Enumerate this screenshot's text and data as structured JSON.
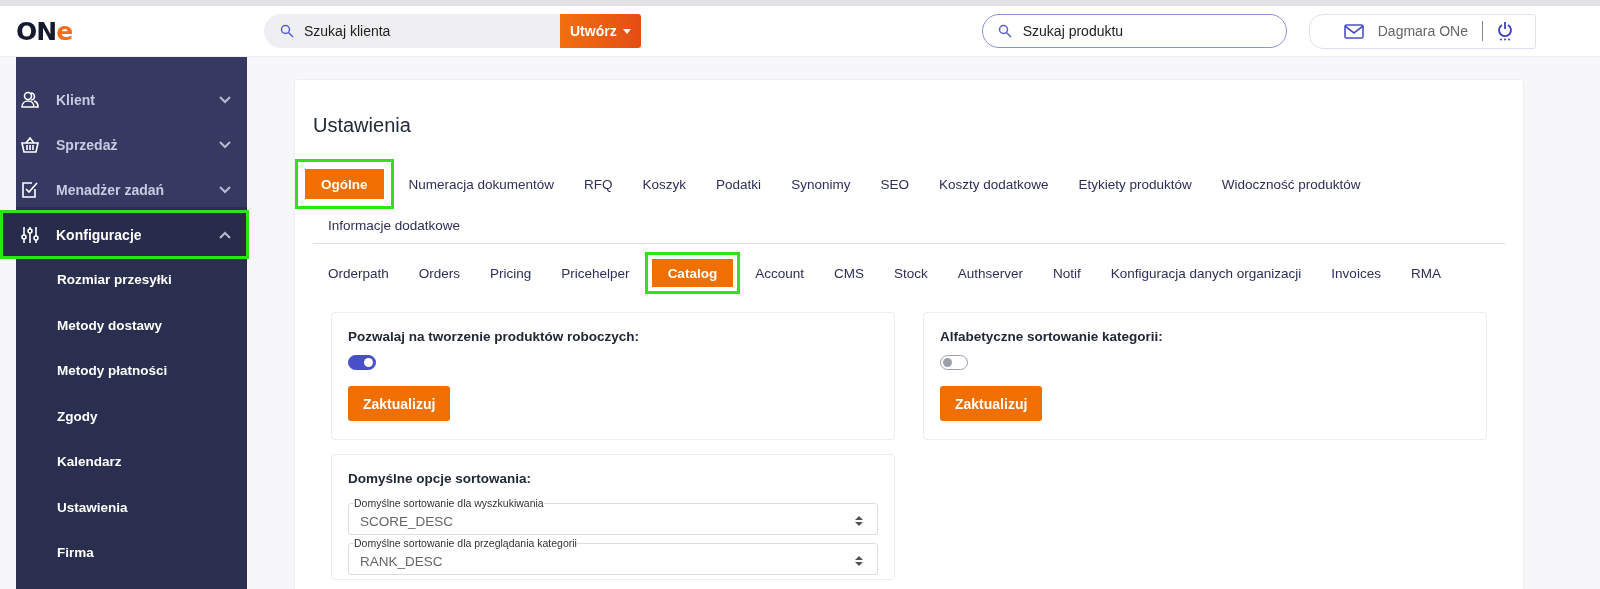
{
  "header": {
    "logo": {
      "text": "ON",
      "accent": "e"
    },
    "client_search": {
      "placeholder": "Szukaj klienta"
    },
    "create_button": {
      "label": "Utwórz"
    },
    "product_search": {
      "placeholder": "Szukaj produktu"
    },
    "user": {
      "name": "Dagmara ONe"
    }
  },
  "sidebar": {
    "items": [
      {
        "label": "Klient",
        "expanded": false,
        "highlighted": false
      },
      {
        "label": "Sprzedaż",
        "expanded": false,
        "highlighted": false
      },
      {
        "label": "Menadżer zadań",
        "expanded": false,
        "highlighted": false
      },
      {
        "label": "Konfiguracje",
        "expanded": true,
        "highlighted": true,
        "children": [
          {
            "label": "Rozmiar przesyłki"
          },
          {
            "label": "Metody dostawy"
          },
          {
            "label": "Metody płatności"
          },
          {
            "label": "Zgody"
          },
          {
            "label": "Kalendarz"
          },
          {
            "label": "Ustawienia"
          },
          {
            "label": "Firma"
          }
        ]
      }
    ]
  },
  "page": {
    "title": "Ustawienia",
    "tabs": [
      {
        "label": "Ogólne",
        "selected": true,
        "highlighted": true
      },
      {
        "label": "Numeracja dokumentów",
        "selected": false,
        "highlighted": false
      },
      {
        "label": "RFQ",
        "selected": false,
        "highlighted": false
      },
      {
        "label": "Koszyk",
        "selected": false,
        "highlighted": false
      },
      {
        "label": "Podatki",
        "selected": false,
        "highlighted": false
      },
      {
        "label": "Synonimy",
        "selected": false,
        "highlighted": false
      },
      {
        "label": "SEO",
        "selected": false,
        "highlighted": false
      },
      {
        "label": "Koszty dodatkowe",
        "selected": false,
        "highlighted": false
      },
      {
        "label": "Etykiety produktów",
        "selected": false,
        "highlighted": false
      },
      {
        "label": "Widoczność produktów",
        "selected": false,
        "highlighted": false
      },
      {
        "label": "Informacje dodatkowe",
        "selected": false,
        "highlighted": false
      }
    ],
    "subtabs": [
      {
        "label": "Orderpath",
        "selected": false,
        "highlighted": false
      },
      {
        "label": "Orders",
        "selected": false,
        "highlighted": false
      },
      {
        "label": "Pricing",
        "selected": false,
        "highlighted": false
      },
      {
        "label": "Pricehelper",
        "selected": false,
        "highlighted": false
      },
      {
        "label": "Catalog",
        "selected": true,
        "highlighted": true
      },
      {
        "label": "Account",
        "selected": false,
        "highlighted": false
      },
      {
        "label": "CMS",
        "selected": false,
        "highlighted": false
      },
      {
        "label": "Stock",
        "selected": false,
        "highlighted": false
      },
      {
        "label": "Authserver",
        "selected": false,
        "highlighted": false
      },
      {
        "label": "Notif",
        "selected": false,
        "highlighted": false
      },
      {
        "label": "Konfiguracja danych organizacji",
        "selected": false,
        "highlighted": false
      },
      {
        "label": "Invoices",
        "selected": false,
        "highlighted": false
      },
      {
        "label": "RMA",
        "selected": false,
        "highlighted": false
      }
    ],
    "cards": [
      {
        "kind": "toggle",
        "title": "Pozwalaj na tworzenie produktów roboczych:",
        "on": true,
        "button": "Zaktualizuj"
      },
      {
        "kind": "toggle",
        "title": "Alfabetyczne sortowanie kategorii:",
        "on": false,
        "button": "Zaktualizuj"
      },
      {
        "kind": "selects",
        "title": "Domyślne opcje sortowania:",
        "selects": [
          {
            "label": "Domyślne sortowanie dla wyszkukiwania",
            "value": "SCORE_DESC"
          },
          {
            "label": "Domyślne sortowanie dla przeglądania kategorii",
            "value": "RANK_DESC"
          }
        ]
      }
    ]
  }
}
